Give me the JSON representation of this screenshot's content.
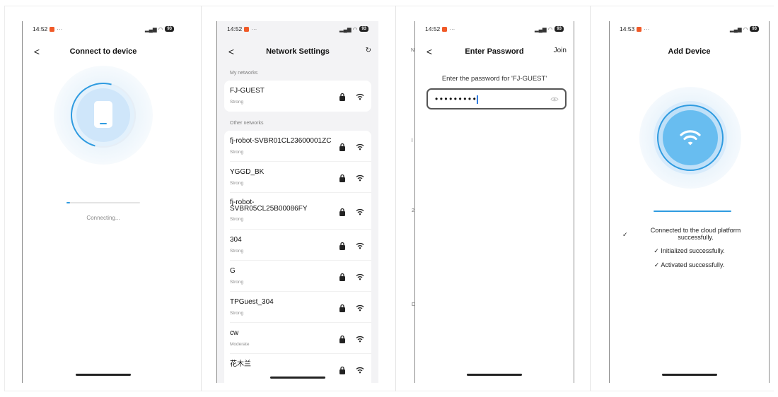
{
  "screens": {
    "connect": {
      "status_time": "14:52",
      "status_dots": "···",
      "status_signal": "沅₈ᵍııl ⊗",
      "battery": "93",
      "title": "Connect to device",
      "back_glyph": "<",
      "progress_fraction": 0.05,
      "status_text": "Connecting..."
    },
    "network": {
      "status_time": "14:52",
      "status_dots": "···",
      "battery": "93",
      "title": "Network Settings",
      "back_glyph": "<",
      "refresh_glyph": "↻",
      "my_networks_label": "My networks",
      "other_networks_label": "Other networks",
      "my_networks": [
        {
          "name": "FJ-GUEST",
          "strength": "Strong"
        }
      ],
      "other_networks": [
        {
          "name": "fj-robot-SVBR01CL23600001ZC",
          "strength": "Strong"
        },
        {
          "name": "YGGD_BK",
          "strength": "Strong"
        },
        {
          "name": "fj-robot-\nSVBR05CL25B00086FY",
          "strength": "Strong"
        },
        {
          "name": "304",
          "strength": "Strong"
        },
        {
          "name": "G",
          "strength": "Strong"
        },
        {
          "name": "TPGuest_304",
          "strength": "Strong"
        },
        {
          "name": "cw",
          "strength": "Moderate"
        },
        {
          "name": "花木兰",
          "strength": ""
        }
      ]
    },
    "password": {
      "status_time": "14:52",
      "status_dots": "···",
      "battery": "93",
      "title": "Enter Password",
      "back_glyph": "<",
      "join_label": "Join",
      "prompt": "Enter the password for 'FJ-GUEST'",
      "masked_value": "•••••••••",
      "edge_chars": [
        "N",
        "l",
        "2",
        "D"
      ]
    },
    "add_device": {
      "status_time": "14:53",
      "status_dots": "···",
      "battery": "93",
      "title": "Add Device",
      "progress_fraction": 1.0,
      "check_glyph": "✓",
      "steps": [
        "Connected to the cloud platform\nsuccessfully.",
        "✓ Initialized successfully.",
        "✓ Activated successfully."
      ]
    }
  },
  "colors": {
    "accent": "#2f9be0",
    "notif": "#f05a28",
    "list_bg": "#f3f3f5"
  },
  "icons": [
    "back-icon",
    "refresh-icon",
    "lock-icon",
    "wifi-icon",
    "eye-icon",
    "check-icon",
    "phone-device-icon",
    "wifi-large-icon"
  ]
}
